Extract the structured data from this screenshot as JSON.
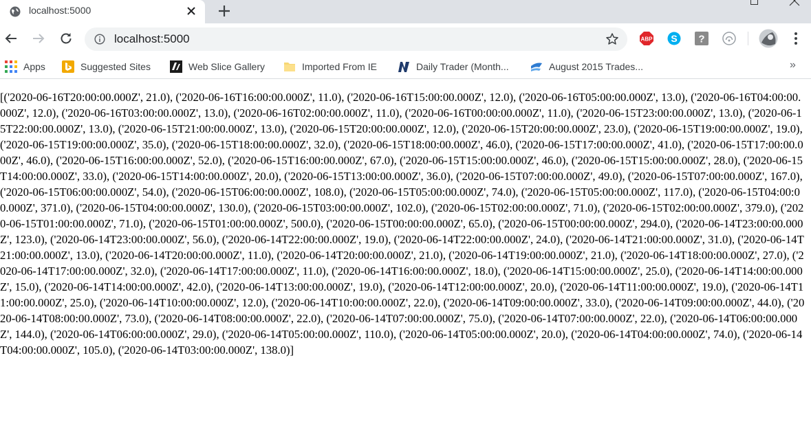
{
  "browser": {
    "tab_title": "localhost:5000",
    "url": "localhost:5000",
    "extensions": [
      "abp-icon",
      "skype-icon",
      "help-icon",
      "cast-icon",
      "profile-avatar"
    ]
  },
  "bookmarks": [
    {
      "label": "Apps",
      "icon": "apps-icon"
    },
    {
      "label": "Suggested Sites",
      "icon": "bing-icon"
    },
    {
      "label": "Web Slice Gallery",
      "icon": "web-slice-icon"
    },
    {
      "label": "Imported From IE",
      "icon": "folder-icon"
    },
    {
      "label": "Daily Trader (Month...",
      "icon": "daily-trader-icon"
    },
    {
      "label": "August 2015 Trades...",
      "icon": "trades-icon"
    }
  ],
  "page": {
    "body_text": "[('2020-06-16T20:00:00.000Z', 21.0), ('2020-06-16T16:00:00.000Z', 11.0), ('2020-06-16T15:00:00.000Z', 12.0), ('2020-06-16T05:00:00.000Z', 13.0), ('2020-06-16T04:00:00.000Z', 12.0), ('2020-06-16T03:00:00.000Z', 13.0), ('2020-06-16T02:00:00.000Z', 11.0), ('2020-06-16T00:00:00.000Z', 11.0), ('2020-06-15T23:00:00.000Z', 13.0), ('2020-06-15T22:00:00.000Z', 13.0), ('2020-06-15T21:00:00.000Z', 13.0), ('2020-06-15T20:00:00.000Z', 12.0), ('2020-06-15T20:00:00.000Z', 23.0), ('2020-06-15T19:00:00.000Z', 19.0), ('2020-06-15T19:00:00.000Z', 35.0), ('2020-06-15T18:00:00.000Z', 32.0), ('2020-06-15T18:00:00.000Z', 46.0), ('2020-06-15T17:00:00.000Z', 41.0), ('2020-06-15T17:00:00.000Z', 46.0), ('2020-06-15T16:00:00.000Z', 52.0), ('2020-06-15T16:00:00.000Z', 67.0), ('2020-06-15T15:00:00.000Z', 46.0), ('2020-06-15T15:00:00.000Z', 28.0), ('2020-06-15T14:00:00.000Z', 33.0), ('2020-06-15T14:00:00.000Z', 20.0), ('2020-06-15T13:00:00.000Z', 36.0), ('2020-06-15T07:00:00.000Z', 49.0), ('2020-06-15T07:00:00.000Z', 167.0), ('2020-06-15T06:00:00.000Z', 54.0), ('2020-06-15T06:00:00.000Z', 108.0), ('2020-06-15T05:00:00.000Z', 74.0), ('2020-06-15T05:00:00.000Z', 117.0), ('2020-06-15T04:00:00.000Z', 371.0), ('2020-06-15T04:00:00.000Z', 130.0), ('2020-06-15T03:00:00.000Z', 102.0), ('2020-06-15T02:00:00.000Z', 71.0), ('2020-06-15T02:00:00.000Z', 379.0), ('2020-06-15T01:00:00.000Z', 71.0), ('2020-06-15T01:00:00.000Z', 500.0), ('2020-06-15T00:00:00.000Z', 65.0), ('2020-06-15T00:00:00.000Z', 294.0), ('2020-06-14T23:00:00.000Z', 123.0), ('2020-06-14T23:00:00.000Z', 56.0), ('2020-06-14T22:00:00.000Z', 19.0), ('2020-06-14T22:00:00.000Z', 24.0), ('2020-06-14T21:00:00.000Z', 31.0), ('2020-06-14T21:00:00.000Z', 13.0), ('2020-06-14T20:00:00.000Z', 11.0), ('2020-06-14T20:00:00.000Z', 21.0), ('2020-06-14T19:00:00.000Z', 21.0), ('2020-06-14T18:00:00.000Z', 27.0), ('2020-06-14T17:00:00.000Z', 32.0), ('2020-06-14T17:00:00.000Z', 11.0), ('2020-06-14T16:00:00.000Z', 18.0), ('2020-06-14T15:00:00.000Z', 25.0), ('2020-06-14T14:00:00.000Z', 15.0), ('2020-06-14T14:00:00.000Z', 42.0), ('2020-06-14T13:00:00.000Z', 19.0), ('2020-06-14T12:00:00.000Z', 20.0), ('2020-06-14T11:00:00.000Z', 19.0), ('2020-06-14T11:00:00.000Z', 25.0), ('2020-06-14T10:00:00.000Z', 12.0), ('2020-06-14T10:00:00.000Z', 22.0), ('2020-06-14T09:00:00.000Z', 33.0), ('2020-06-14T09:00:00.000Z', 44.0), ('2020-06-14T08:00:00.000Z', 73.0), ('2020-06-14T08:00:00.000Z', 22.0), ('2020-06-14T07:00:00.000Z', 75.0), ('2020-06-14T07:00:00.000Z', 22.0), ('2020-06-14T06:00:00.000Z', 144.0), ('2020-06-14T06:00:00.000Z', 29.0), ('2020-06-14T05:00:00.000Z', 110.0), ('2020-06-14T05:00:00.000Z', 20.0), ('2020-06-14T04:00:00.000Z', 74.0), ('2020-06-14T04:00:00.000Z', 105.0), ('2020-06-14T03:00:00.000Z', 138.0)]"
  },
  "colors": {
    "tabstrip": "#dee1e6",
    "omnibox": "#f1f3f4",
    "abp_red": "#e0262a",
    "skype_blue": "#00aff0",
    "apps_dots": [
      "#ea4335",
      "#fbbc05",
      "#34a853",
      "#4285f4"
    ]
  }
}
